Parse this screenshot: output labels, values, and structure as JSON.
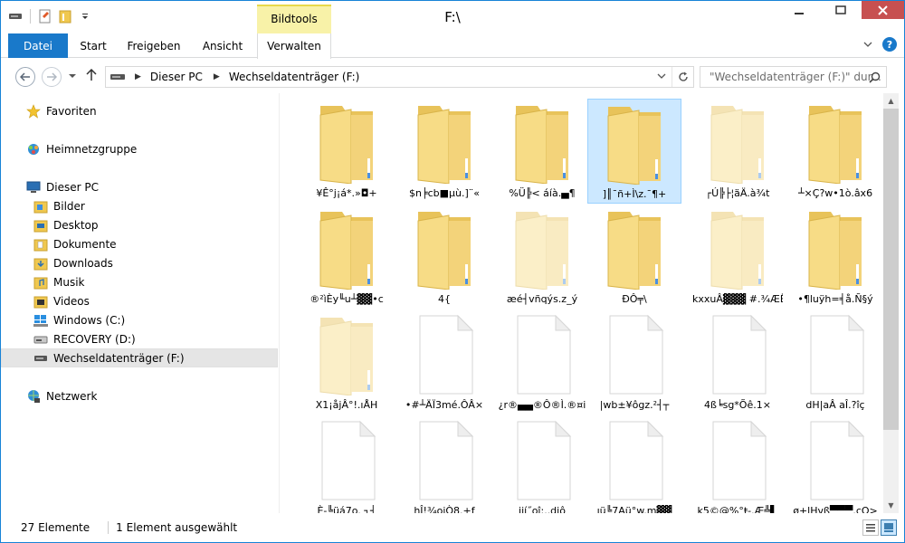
{
  "window": {
    "title": "F:\\",
    "context_tab_group": "Bildtools"
  },
  "ribbon": {
    "tabs": [
      "Datei",
      "Start",
      "Freigeben",
      "Ansicht",
      "Verwalten"
    ]
  },
  "address": {
    "crumbs": [
      "Dieser PC",
      "Wechseldatenträger (F:)"
    ],
    "search_placeholder": "\"Wechseldatenträger (F:)\" dur..."
  },
  "nav": {
    "favorites": "Favoriten",
    "homegroup": "Heimnetzgruppe",
    "this_pc": "Dieser PC",
    "pc_items": [
      "Bilder",
      "Desktop",
      "Dokumente",
      "Downloads",
      "Musik",
      "Videos",
      "Windows (C:)",
      "RECOVERY (D:)",
      "Wechseldatenträger (F:)"
    ],
    "network": "Netzwerk"
  },
  "items": [
    {
      "name": "¥Ê°j¡á*.»◘+",
      "type": "folder",
      "faded": false
    },
    {
      "name": "$n╞cb■µù.]¨«",
      "type": "folder",
      "faded": false
    },
    {
      "name": "%Ü╠<  áíà.▄¶",
      "type": "folder",
      "faded": false
    },
    {
      "name": "]║¯ñ+Ì\\z.¯¶+",
      "type": "folder",
      "faded": false,
      "selected": true
    },
    {
      "name": "┌Ú╠├¦äÄ.à¾t",
      "type": "folder",
      "faded": true
    },
    {
      "name": "┴×Ç?w•1ò.âx6",
      "type": "folder",
      "faded": false
    },
    {
      "name": "®²ìÈy╙u┴▓▓•c",
      "type": "folder",
      "faded": false
    },
    {
      "name": "4{",
      "type": "folder",
      "faded": false
    },
    {
      "name": "æé┤vñqýs.z_ý",
      "type": "folder",
      "faded": true
    },
    {
      "name": "ÐÔ╤\\",
      "type": "folder",
      "faded": false
    },
    {
      "name": "kxxuÂ▓▓▓ #.¾ÆË",
      "type": "folder",
      "faded": true
    },
    {
      "name": "•¶luÿh=╡å.Ñ§ý",
      "type": "folder",
      "faded": false
    },
    {
      "name": "X1¡åjÂ°!.ıÅH",
      "type": "folder",
      "faded": true
    },
    {
      "name": "•#┴ÄÏ3mé.ÔÂ×",
      "type": "file",
      "faded": false
    },
    {
      "name": "¿r®▄▄®Ô®Ì.®¤i",
      "type": "file",
      "faded": false
    },
    {
      "name": "|wb±¥ôgz.²┤┬",
      "type": "file",
      "faded": false
    },
    {
      "name": "4ß╘sg*Õê.1×",
      "type": "file",
      "faded": false
    },
    {
      "name": "dH|aÂ aÎ.?îç",
      "type": "file",
      "faded": false
    },
    {
      "name": "È-╚üá7o.  ┐┤",
      "type": "file",
      "faded": false
    },
    {
      "name": "hÎ!¾oiÒ8.+f",
      "type": "file",
      "faded": false
    },
    {
      "name": "iií˝oî:..diô",
      "type": "file",
      "faded": false
    },
    {
      "name": "ıü╚7Aü°w.m▓▓",
      "type": "file",
      "faded": false
    },
    {
      "name": "k5©@%°ŧ-.Æ╩▌",
      "type": "file",
      "faded": false
    },
    {
      "name": "ø+lHvß▀▀▀.cO>",
      "type": "file",
      "faded": false
    }
  ],
  "status": {
    "count": "27 Elemente",
    "selection": "1 Element ausgewählt"
  },
  "colors": {
    "accent": "#1979ca",
    "selection": "#cce8ff",
    "folder": "#f3d47a",
    "context_tab": "#f8f2a8"
  }
}
